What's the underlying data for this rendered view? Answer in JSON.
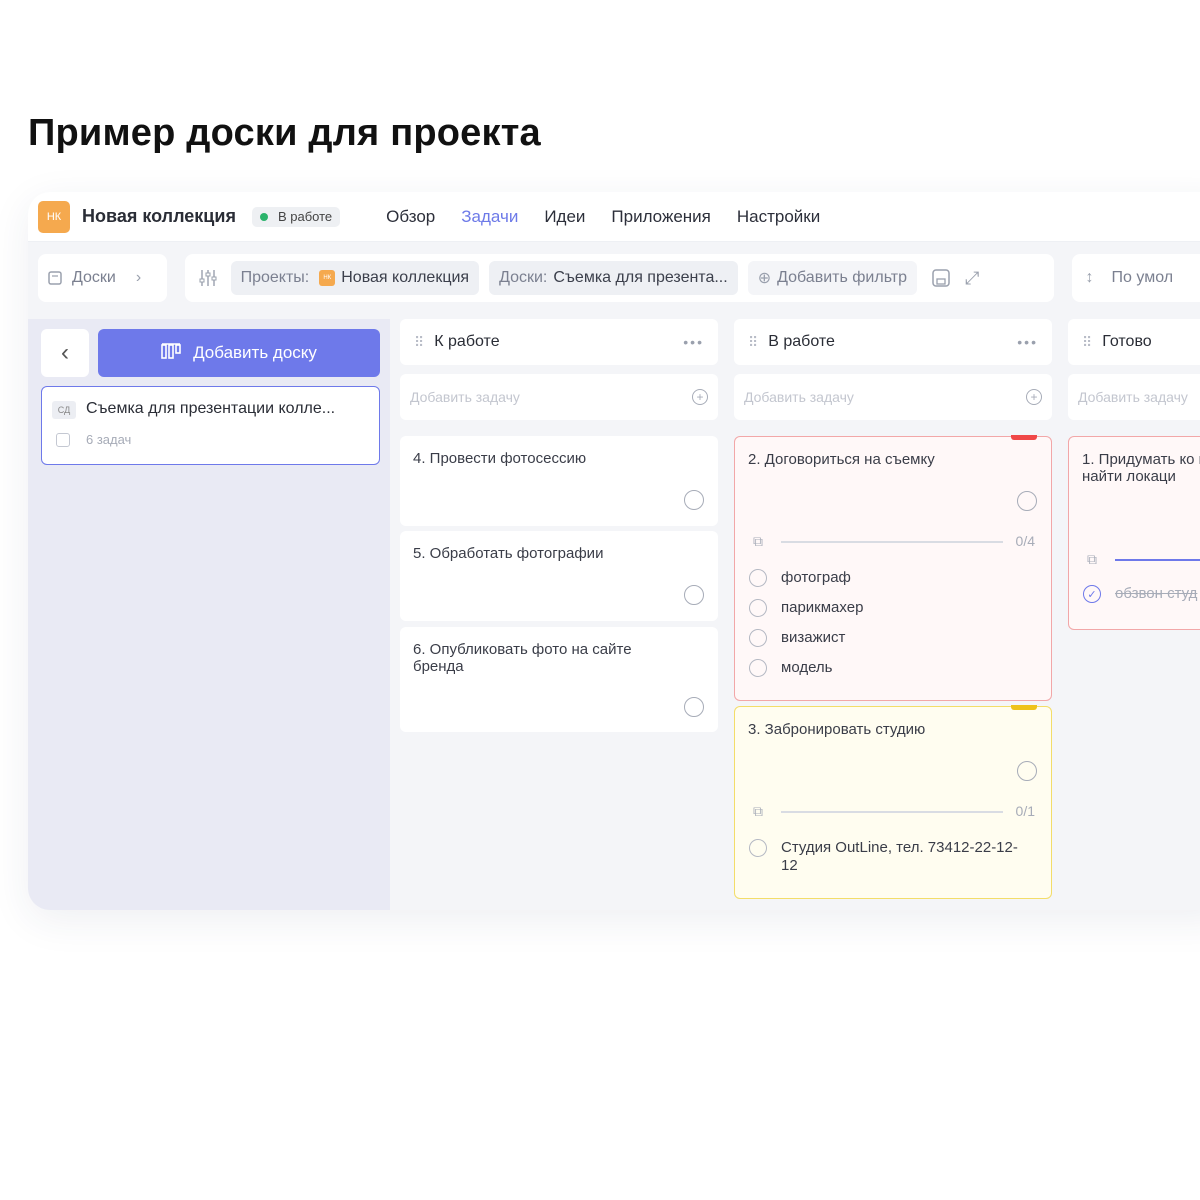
{
  "heading": "Пример доски для проекта",
  "project": {
    "avatar": "НК",
    "name": "Новая коллекция",
    "status": "В работе"
  },
  "nav": {
    "overview": "Обзор",
    "tasks": "Задачи",
    "ideas": "Идеи",
    "apps": "Приложения",
    "settings": "Настройки"
  },
  "filters": {
    "boards_label": "Доски",
    "projects_label": "Проекты:",
    "project_avatar": "НК",
    "project_value": "Новая коллекция",
    "board_label": "Доски:",
    "board_value": "Съемка для презента...",
    "add_filter": "Добавить фильтр",
    "sort": "По умол"
  },
  "sidebar": {
    "add_board": "Добавить доску",
    "board": {
      "abbr": "СД",
      "title": "Съемка для презентации колле...",
      "count": "6 задач"
    }
  },
  "columns": {
    "todo": {
      "title": "К работе",
      "add_placeholder": "Добавить задачу",
      "tasks": [
        {
          "title": "4. Провести фотосессию"
        },
        {
          "title": "5. Обработать фотографии"
        },
        {
          "title": "6. Опубликовать фото на сайте бренда"
        }
      ]
    },
    "inwork": {
      "title": "В работе",
      "add_placeholder": "Добавить задачу",
      "tasks": [
        {
          "title": "2. Договориться на съемку",
          "priority_color": "#f04848",
          "progress_text": "0/4",
          "progress": 0,
          "subtasks": [
            "фотограф",
            "парикмахер",
            "визажист",
            "модель"
          ]
        },
        {
          "title": "3. Забронировать студию",
          "priority_color": "#eec21b",
          "progress_text": "0/1",
          "progress": 0,
          "subtasks": [
            "Студия OutLine, тел. 73412-22-12-12"
          ]
        }
      ]
    },
    "done": {
      "title": "Готово",
      "add_placeholder": "Добавить задачу",
      "tasks": [
        {
          "title": "1. Придумать ко и найти локаци",
          "progress": 1,
          "subtasks": [
            "обзвон студ"
          ]
        }
      ]
    }
  }
}
